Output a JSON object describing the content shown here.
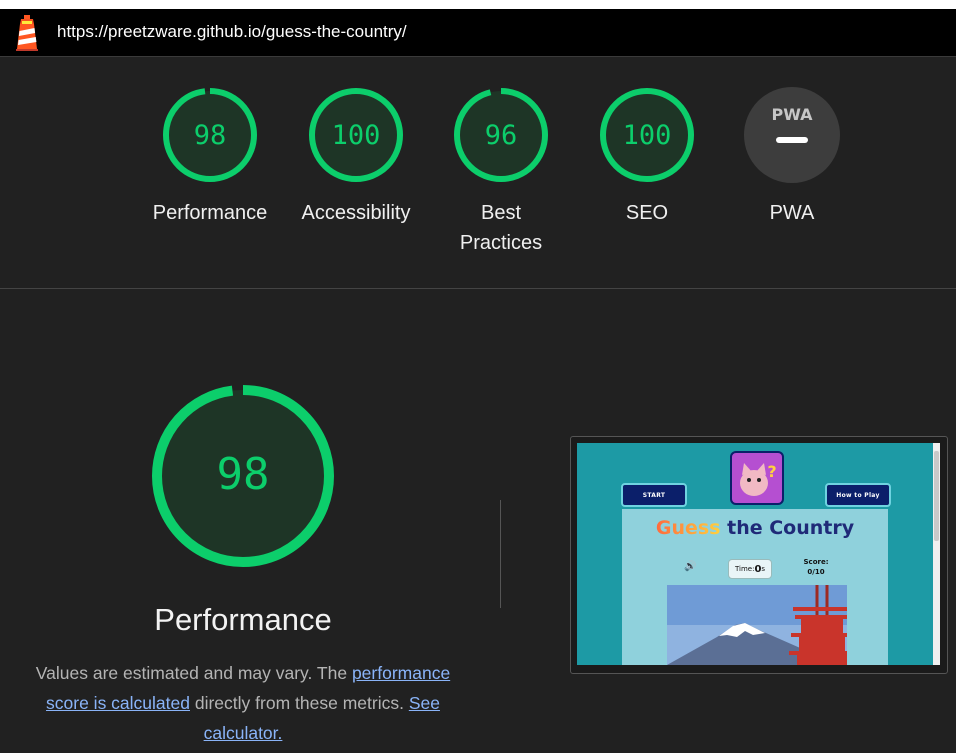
{
  "header": {
    "logo_icon": "lighthouse-icon",
    "url": "https://preetzware.github.io/guess-the-country/"
  },
  "summary": {
    "gauges": [
      {
        "label": "Performance",
        "score": 98,
        "display": "98",
        "color": "#0cce6b"
      },
      {
        "label": "Accessibility",
        "score": 100,
        "display": "100",
        "color": "#0cce6b"
      },
      {
        "label": "Best Practices",
        "score": 96,
        "display": "96",
        "color": "#0cce6b"
      },
      {
        "label": "SEO",
        "score": 100,
        "display": "100",
        "color": "#0cce6b"
      },
      {
        "label": "PWA",
        "badge_text": "PWA",
        "icon": "pwa-badge-icon"
      }
    ]
  },
  "performance": {
    "score": 98,
    "display": "98",
    "title": "Performance",
    "desc_1": "Values are estimated and may vary. The ",
    "link_1": "performance score is calculated",
    "desc_2": " directly from these metrics. ",
    "link_2": "See calculator."
  },
  "screenshot": {
    "start_label": "START",
    "howto_label": "How to Play",
    "title_part1": "Guess",
    "title_part2": " the Country",
    "time_label": "Time:",
    "time_value": "0",
    "time_unit": "s",
    "score_label": "Score:",
    "score_value": "0/10",
    "speaker_icon": "speaker-icon",
    "mascot_icon": "cat-question-icon"
  },
  "colors": {
    "pass": "#0cce6b",
    "background": "#212121",
    "link": "#8ab4f8"
  }
}
